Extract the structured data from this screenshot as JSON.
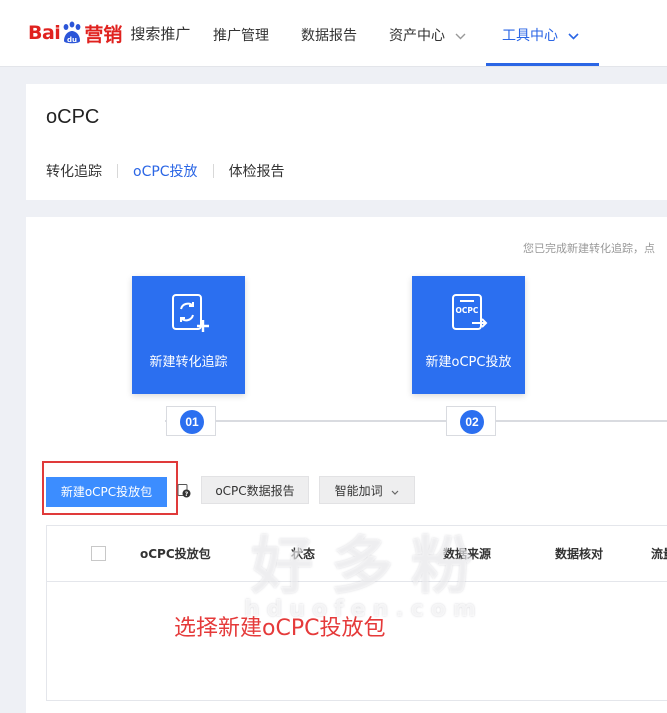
{
  "brand": {
    "logo_text_baidu": "Bai",
    "logo_text_du": "du",
    "logo_text_yingxiao": "营销",
    "sub": "搜索推广"
  },
  "nav": {
    "items": [
      {
        "label": "推广管理"
      },
      {
        "label": "数据报告"
      },
      {
        "label": "资产中心"
      },
      {
        "label": "工具中心"
      }
    ]
  },
  "header": {
    "title": "oCPC",
    "tabs": [
      {
        "label": "转化追踪"
      },
      {
        "label": "oCPC投放"
      },
      {
        "label": "体检报告"
      }
    ]
  },
  "main": {
    "hint": "您已完成新建转化追踪，点",
    "steps": [
      {
        "label": "新建转化追踪",
        "number": "01"
      },
      {
        "label": "新建oCPC投放",
        "number": "02"
      }
    ],
    "toolbar": {
      "new_package": "新建oCPC投放包",
      "data_report": "oCPC数据报告",
      "smart_add": "智能加词"
    },
    "table": {
      "columns": [
        "oCPC投放包",
        "状态",
        "数据来源",
        "数据核对",
        "流量"
      ]
    },
    "annotation": "选择新建oCPC投放包"
  },
  "watermark": {
    "cn": "好多粉",
    "en": "hduofen.com"
  },
  "colors": {
    "accent": "#2b66e5",
    "step_box": "#2b6ff0",
    "primary_button": "#3c8dff",
    "annotation_red": "#e53a3a"
  }
}
